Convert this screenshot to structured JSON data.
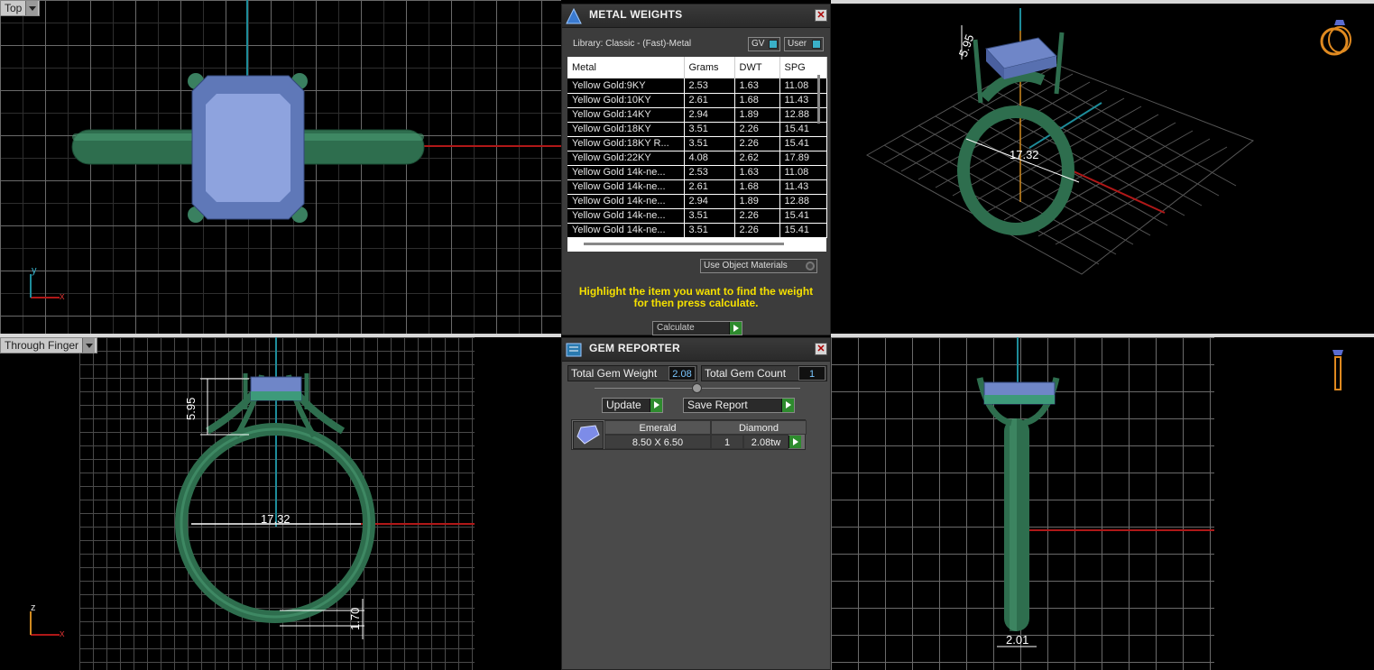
{
  "viewports": {
    "top": {
      "label": "Top",
      "axis_x": "x",
      "axis_y": "y"
    },
    "through_finger": {
      "label": "Through Finger",
      "axis_x": "x",
      "axis_y": "z",
      "dim_height": "5.95",
      "dim_inner": "17.32",
      "dim_shank": "1.70"
    },
    "perspective": {
      "dim_height": "5.95",
      "dim_inner": "17.32"
    },
    "side": {
      "dim_width": "2.01"
    }
  },
  "metal_weights": {
    "title": "METAL WEIGHTS",
    "library_text": "Library: Classic - (Fast)-Metal",
    "gv_label": "GV",
    "user_label": "User",
    "columns": [
      "Metal",
      "Grams",
      "DWT",
      "SPG"
    ],
    "rows": [
      [
        "Yellow Gold:9KY",
        "2.53",
        "1.63",
        "11.08"
      ],
      [
        "Yellow Gold:10KY",
        "2.61",
        "1.68",
        "11.43"
      ],
      [
        "Yellow Gold:14KY",
        "2.94",
        "1.89",
        "12.88"
      ],
      [
        "Yellow Gold:18KY",
        "3.51",
        "2.26",
        "15.41"
      ],
      [
        "Yellow Gold:18KY R...",
        "3.51",
        "2.26",
        "15.41"
      ],
      [
        "Yellow Gold:22KY",
        "4.08",
        "2.62",
        "17.89"
      ],
      [
        "Yellow Gold 14k-ne...",
        "2.53",
        "1.63",
        "11.08"
      ],
      [
        "Yellow Gold 14k-ne...",
        "2.61",
        "1.68",
        "11.43"
      ],
      [
        "Yellow Gold 14k-ne...",
        "2.94",
        "1.89",
        "12.88"
      ],
      [
        "Yellow Gold 14k-ne...",
        "3.51",
        "2.26",
        "15.41"
      ],
      [
        "Yellow Gold 14k-ne...",
        "3.51",
        "2.26",
        "15.41"
      ]
    ],
    "use_object_materials": "Use Object Materials",
    "instruction_line1": "Highlight the item you want to find the weight",
    "instruction_line2": "for then press calculate.",
    "calculate_label": "Calculate"
  },
  "gem_reporter": {
    "title": "GEM REPORTER",
    "total_weight_label": "Total Gem Weight",
    "total_weight_value": "2.08",
    "total_count_label": "Total Gem Count",
    "total_count_value": "1",
    "update_label": "Update",
    "save_report_label": "Save Report",
    "gem": {
      "shape": "Emerald",
      "material": "Diamond",
      "size": "8.50 X 6.50",
      "count": "1",
      "weight": "2.08tw"
    }
  },
  "colors": {
    "ring_green": "#2e6e4e",
    "gem_blue": "#6f86c8",
    "axis_red": "#b01818",
    "axis_teal": "#1e8c9a",
    "instruction_yellow": "#f5e000"
  }
}
